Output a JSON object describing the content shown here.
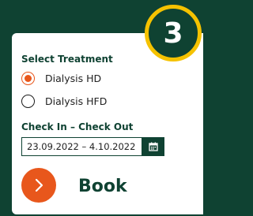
{
  "step": {
    "number": "3"
  },
  "treatment": {
    "label": "Select Treatment",
    "options": [
      {
        "label": "Dialysis HD",
        "selected": true
      },
      {
        "label": "Dialysis HFD",
        "selected": false
      }
    ]
  },
  "dates": {
    "label": "Check In – Check Out",
    "value": "23.09.2022 – 4.10.2022",
    "button_icon": "calendar-icon"
  },
  "book": {
    "label": "Book",
    "icon": "chevron-right-icon"
  },
  "colors": {
    "background": "#0f4232",
    "accent": "#e8571c",
    "badge_border": "#f5c200",
    "card": "#ffffff"
  }
}
